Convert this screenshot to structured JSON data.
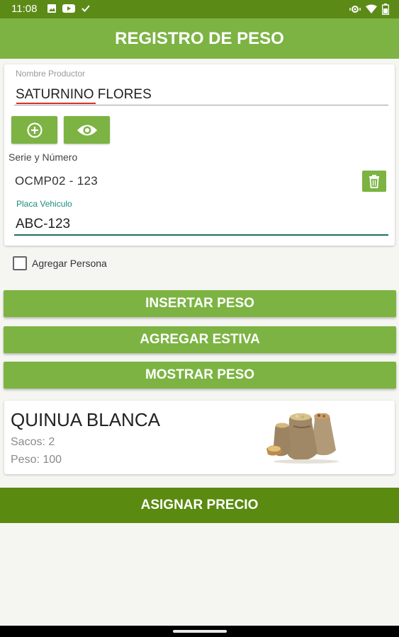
{
  "status_bar": {
    "time": "11:08",
    "left_icons": [
      "image-icon",
      "youtube-icon",
      "check-icon"
    ],
    "right_icons": [
      "vibrate-icon",
      "wifi-icon",
      "battery-icon"
    ]
  },
  "app_bar": {
    "title": "REGISTRO DE PESO"
  },
  "form": {
    "productor_label": "Nombre Productor",
    "productor_value": "SATURNINO FLORES",
    "add_icon": "add-circle-icon",
    "view_icon": "eye-icon",
    "serie_label": "Serie y Número",
    "serie_value": "OCMP02 - 123",
    "delete_icon": "trash-icon",
    "placa_label": "Placa Vehiculo",
    "placa_value": "ABC-123"
  },
  "agregar_persona": {
    "label": "Agregar Persona",
    "checked": false
  },
  "buttons": {
    "insertar_peso": "INSERTAR PESO",
    "agregar_estiva": "AGREGAR ESTIVA",
    "mostrar_peso": "MOSTRAR PESO",
    "asignar_precio": "ASIGNAR PRECIO"
  },
  "product": {
    "name": "QUINUA BLANCA",
    "sacos": "Sacos: 2",
    "peso": "Peso: 100",
    "image": "grain-sacks-image"
  },
  "colors": {
    "primary": "#7cb342",
    "primary_dark": "#5a8a10",
    "status_bar": "#5c8a17",
    "accent_teal": "#1e8c7e"
  }
}
